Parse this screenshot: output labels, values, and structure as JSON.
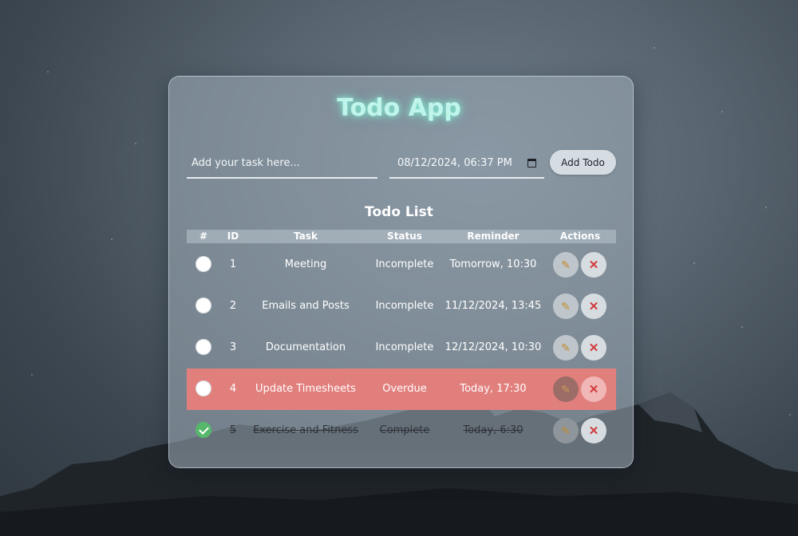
{
  "app": {
    "title": "Todo App"
  },
  "form": {
    "task_placeholder": "Add your task here...",
    "datetime_value": "08/12/2024, 06:37 PM",
    "add_label": "Add Todo"
  },
  "list": {
    "title": "Todo List",
    "columns": [
      "#",
      "ID",
      "Task",
      "Status",
      "Reminder",
      "Actions"
    ],
    "rows": [
      {
        "checked": false,
        "id": "1",
        "task": "Meeting",
        "status": "Incomplete",
        "reminder": "Tomorrow, 10:30",
        "state": "normal"
      },
      {
        "checked": false,
        "id": "2",
        "task": "Emails and Posts",
        "status": "Incomplete",
        "reminder": "11/12/2024, 13:45",
        "state": "normal"
      },
      {
        "checked": false,
        "id": "3",
        "task": "Documentation",
        "status": "Incomplete",
        "reminder": "12/12/2024, 10:30",
        "state": "normal"
      },
      {
        "checked": false,
        "id": "4",
        "task": "Update Timesheets",
        "status": "Overdue",
        "reminder": "Today, 17:30",
        "state": "overdue"
      },
      {
        "checked": true,
        "id": "5",
        "task": "Exercise and Fitness",
        "status": "Complete",
        "reminder": "Today, 6:30",
        "state": "done"
      }
    ]
  },
  "icons": {
    "edit": "pencil-icon",
    "delete": "close-icon",
    "calendar": "calendar-icon",
    "check": "checkmark-icon"
  },
  "colors": {
    "title_glow": "#bff5ea",
    "overdue_row": "#e17f7d",
    "checked": "#57b86c",
    "delete_icon": "#d23b3b"
  }
}
